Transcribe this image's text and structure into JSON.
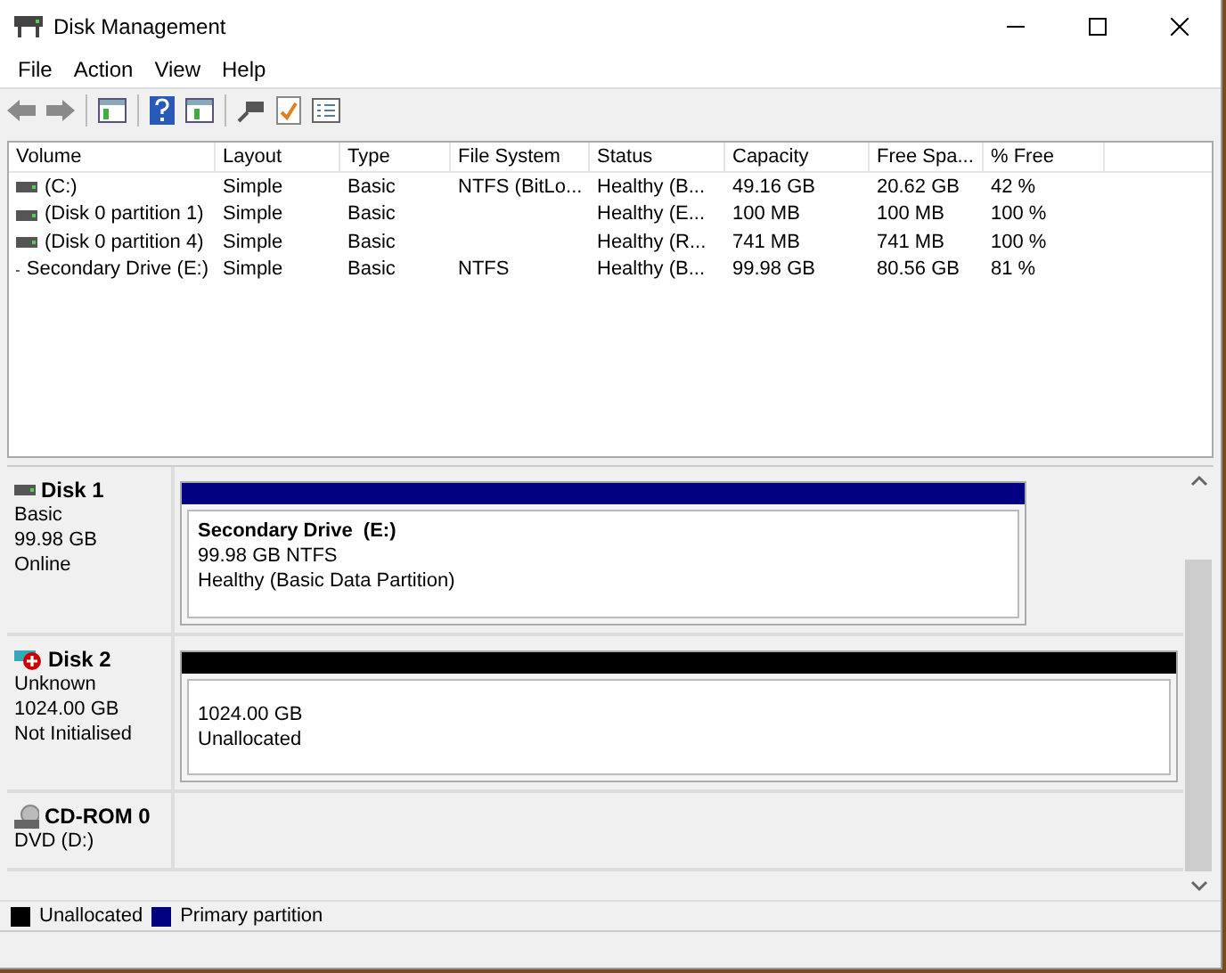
{
  "window": {
    "title": "Disk Management"
  },
  "menu": [
    "File",
    "Action",
    "View",
    "Help"
  ],
  "table": {
    "columns": [
      "Volume",
      "Layout",
      "Type",
      "File System",
      "Status",
      "Capacity",
      "Free Spa...",
      "% Free"
    ],
    "rows": [
      [
        "(C:)",
        "Simple",
        "Basic",
        "NTFS (BitLo...",
        "Healthy (B...",
        "49.16 GB",
        "20.62 GB",
        "42 %"
      ],
      [
        "(Disk 0 partition 1)",
        "Simple",
        "Basic",
        "",
        "Healthy (E...",
        "100 MB",
        "100 MB",
        "100 %"
      ],
      [
        "(Disk 0 partition 4)",
        "Simple",
        "Basic",
        "",
        "Healthy (R...",
        "741 MB",
        "741 MB",
        "100 %"
      ],
      [
        "Secondary Drive (E:)",
        "Simple",
        "Basic",
        "NTFS",
        "Healthy (B...",
        "99.98 GB",
        "80.56 GB",
        "81 %"
      ]
    ]
  },
  "disks": [
    {
      "name": "Disk 1",
      "kind": "disk",
      "lines": [
        "Basic",
        "99.98 GB",
        "Online"
      ],
      "partitions": [
        {
          "kind": "primary",
          "title": "Secondary Drive  (E:)",
          "lines": [
            "99.98 GB NTFS",
            "Healthy (Basic Data Partition)"
          ]
        }
      ]
    },
    {
      "name": "Disk 2",
      "kind": "uninitialised",
      "lines": [
        "Unknown",
        "1024.00 GB",
        "Not Initialised"
      ],
      "partitions": [
        {
          "kind": "unallocated",
          "lines": [
            "1024.00 GB",
            "Unallocated"
          ]
        }
      ]
    },
    {
      "name": "CD-ROM 0",
      "kind": "cdrom",
      "lines": [
        "DVD (D:)"
      ]
    }
  ],
  "legend": [
    {
      "label": "Unallocated",
      "color": "#000000"
    },
    {
      "label": "Primary partition",
      "color": "#000080"
    }
  ]
}
